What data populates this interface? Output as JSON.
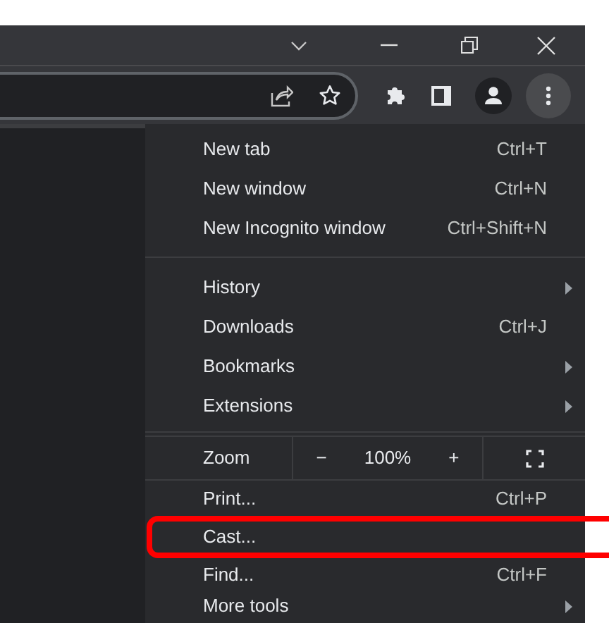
{
  "menu": {
    "sections": [
      {
        "items": [
          {
            "kind": "command",
            "label": "New tab",
            "shortcut": "Ctrl+T",
            "highlighted": false
          },
          {
            "kind": "command",
            "label": "New window",
            "shortcut": "Ctrl+N",
            "highlighted": false
          },
          {
            "kind": "command",
            "label": "New Incognito window",
            "shortcut": "Ctrl+Shift+N",
            "highlighted": false
          }
        ]
      },
      {
        "items": [
          {
            "kind": "submenu",
            "label": "History",
            "highlighted": false
          },
          {
            "kind": "command",
            "label": "Downloads",
            "shortcut": "Ctrl+J",
            "highlighted": false
          },
          {
            "kind": "submenu",
            "label": "Bookmarks",
            "highlighted": false
          },
          {
            "kind": "submenu",
            "label": "Extensions",
            "highlighted": false
          }
        ]
      },
      {
        "items": [
          {
            "kind": "zoom",
            "label": "Zoom",
            "minus": "−",
            "value": "100%",
            "plus": "+",
            "highlighted": false
          }
        ]
      },
      {
        "items": [
          {
            "kind": "command",
            "label": "Print...",
            "shortcut": "Ctrl+P",
            "highlighted": false
          },
          {
            "kind": "command",
            "label": "Cast...",
            "highlighted": true
          },
          {
            "kind": "command",
            "label": "Find...",
            "shortcut": "Ctrl+F",
            "highlighted": false
          },
          {
            "kind": "submenu",
            "label": "More tools",
            "highlighted": false
          }
        ]
      }
    ]
  }
}
